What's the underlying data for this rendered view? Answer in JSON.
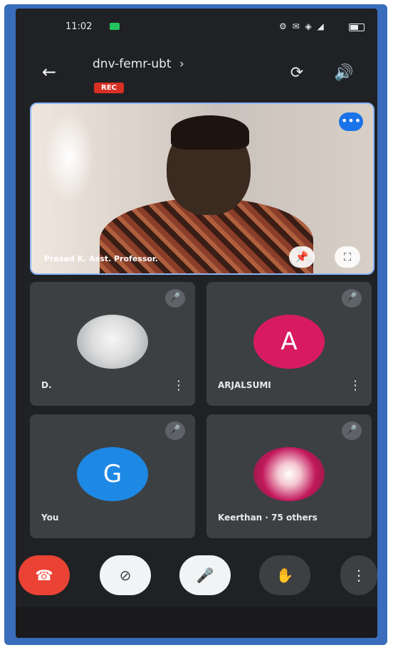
{
  "status_bar": {
    "time": "11:02",
    "system_icons": "⚙ ✉ ◈ ◢"
  },
  "header": {
    "meeting_code": "dnv-femr-ubt",
    "rec_label": "REC",
    "chevron": "›"
  },
  "main_tile": {
    "participant_name": "Prasad K. Asst. Professor."
  },
  "tiles": [
    {
      "name": "D.",
      "avatar_letter": "",
      "avatar_color": ""
    },
    {
      "name": "ARJALSUMI",
      "avatar_letter": "A",
      "avatar_color": "#d81b60"
    },
    {
      "name": "You",
      "avatar_letter": "G",
      "avatar_color": "#1e88e5"
    },
    {
      "name": "Keerthan · 75 others",
      "avatar_letter": "",
      "avatar_color": ""
    }
  ],
  "colors": {
    "end_call": "#ea4335",
    "accent": "#8ab4f8"
  }
}
